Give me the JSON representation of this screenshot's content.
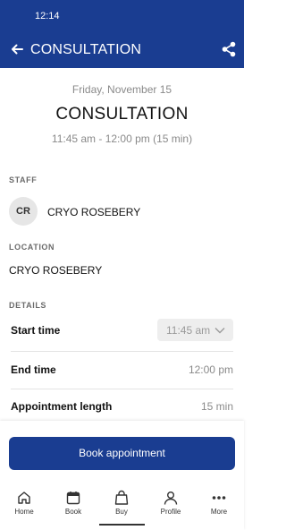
{
  "status_bar": {
    "time": "12:14"
  },
  "app_bar": {
    "title": "CONSULTATION",
    "back_icon": "arrow-left-icon",
    "share_icon": "share-icon"
  },
  "header": {
    "date": "Friday, November 15",
    "title": "CONSULTATION",
    "time_range": "11:45 am - 12:00 pm (15 min)"
  },
  "staff": {
    "label": "STAFF",
    "initials": "CR",
    "name": "CRYO ROSEBERY"
  },
  "location": {
    "label": "LOCATION",
    "name": "CRYO ROSEBERY"
  },
  "details": {
    "label": "DETAILS",
    "start_time_label": "Start time",
    "start_time_value": "11:45 am",
    "end_time_label": "End time",
    "end_time_value": "12:00 pm",
    "length_label": "Appointment length",
    "length_value": "15 min"
  },
  "actions": {
    "book_label": "Book appointment"
  },
  "bottom_nav": {
    "items": [
      {
        "label": "Home",
        "icon": "home-icon"
      },
      {
        "label": "Book",
        "icon": "calendar-icon"
      },
      {
        "label": "Buy",
        "icon": "shopping-bag-icon"
      },
      {
        "label": "Profile",
        "icon": "person-icon"
      },
      {
        "label": "More",
        "icon": "more-icon"
      }
    ],
    "active": "Buy"
  },
  "colors": {
    "primary": "#1a3d91",
    "muted_text": "#8a8a8a",
    "select_background": "#eeeeee"
  }
}
